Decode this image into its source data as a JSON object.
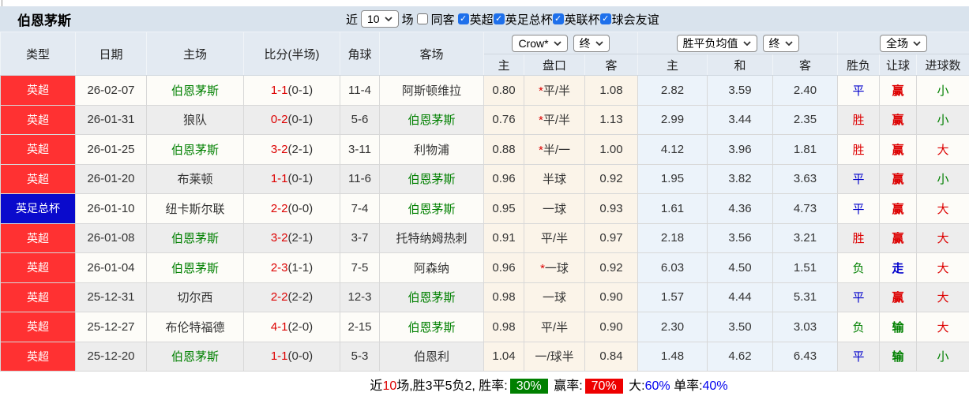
{
  "page": {
    "title": "伯恩茅斯"
  },
  "toolbar": {
    "near_label": "近",
    "matches_count": "10",
    "matches_label": "场",
    "same_opponent": {
      "label": "同客",
      "checked": false
    },
    "league_filters": [
      {
        "label": "英超",
        "checked": true
      },
      {
        "label": "英足总杯",
        "checked": true
      },
      {
        "label": "英联杯",
        "checked": true
      },
      {
        "label": "球会友谊",
        "checked": true
      }
    ]
  },
  "table": {
    "headers": {
      "type": "类型",
      "date": "日期",
      "home": "主场",
      "score": "比分(半场)",
      "corner": "角球",
      "away": "客场",
      "odds_company_select": "Crow*",
      "odds_time_select": "终",
      "odds_cols": {
        "home": "主",
        "handicap": "盘口",
        "away": "客"
      },
      "avg_select": "胜平负均值",
      "avg_time_select": "终",
      "avg_cols": {
        "home": "主",
        "draw": "和",
        "away": "客"
      },
      "scope_select": "全场",
      "result_cols": {
        "result": "胜负",
        "handicap": "让球",
        "goals": "进球数"
      }
    },
    "rows": [
      {
        "league": "英超",
        "league_color": "red",
        "date": "26-02-07",
        "home": {
          "name": "伯恩茅斯",
          "highlight": true
        },
        "score": {
          "full": "1-1",
          "half": "(0-1)"
        },
        "corners": "11-4",
        "away": {
          "name": "阿斯顿维拉",
          "highlight": false
        },
        "odds": {
          "home": "0.80",
          "star": "*",
          "handicap": "平/半",
          "away": "1.08"
        },
        "avg": {
          "home": "2.82",
          "draw": "3.59",
          "away": "2.40"
        },
        "result": {
          "text": "平",
          "color": "blue"
        },
        "handicap_result": {
          "text": "赢",
          "color": "red"
        },
        "goals_result": {
          "text": "小",
          "color": "green"
        }
      },
      {
        "league": "英超",
        "league_color": "red",
        "date": "26-01-31",
        "home": {
          "name": "狼队",
          "highlight": false
        },
        "score": {
          "full": "0-2",
          "half": "(0-1)"
        },
        "corners": "5-6",
        "away": {
          "name": "伯恩茅斯",
          "highlight": true
        },
        "odds": {
          "home": "0.76",
          "star": "*",
          "handicap": "平/半",
          "away": "1.13"
        },
        "avg": {
          "home": "2.99",
          "draw": "3.44",
          "away": "2.35"
        },
        "result": {
          "text": "胜",
          "color": "red"
        },
        "handicap_result": {
          "text": "赢",
          "color": "red"
        },
        "goals_result": {
          "text": "小",
          "color": "green"
        }
      },
      {
        "league": "英超",
        "league_color": "red",
        "date": "26-01-25",
        "home": {
          "name": "伯恩茅斯",
          "highlight": true
        },
        "score": {
          "full": "3-2",
          "half": "(2-1)"
        },
        "corners": "3-11",
        "away": {
          "name": "利物浦",
          "highlight": false
        },
        "odds": {
          "home": "0.88",
          "star": "*",
          "handicap": "半/一",
          "away": "1.00"
        },
        "avg": {
          "home": "4.12",
          "draw": "3.96",
          "away": "1.81"
        },
        "result": {
          "text": "胜",
          "color": "red"
        },
        "handicap_result": {
          "text": "赢",
          "color": "red"
        },
        "goals_result": {
          "text": "大",
          "color": "red"
        }
      },
      {
        "league": "英超",
        "league_color": "red",
        "date": "26-01-20",
        "home": {
          "name": "布莱顿",
          "highlight": false
        },
        "score": {
          "full": "1-1",
          "half": "(0-1)"
        },
        "corners": "11-6",
        "away": {
          "name": "伯恩茅斯",
          "highlight": true
        },
        "odds": {
          "home": "0.96",
          "star": "",
          "handicap": "半球",
          "away": "0.92"
        },
        "avg": {
          "home": "1.95",
          "draw": "3.82",
          "away": "3.63"
        },
        "result": {
          "text": "平",
          "color": "blue"
        },
        "handicap_result": {
          "text": "赢",
          "color": "red"
        },
        "goals_result": {
          "text": "小",
          "color": "green"
        }
      },
      {
        "league": "英足总杯",
        "league_color": "blue",
        "date": "26-01-10",
        "home": {
          "name": "纽卡斯尔联",
          "highlight": false
        },
        "score": {
          "full": "2-2",
          "half": "(0-0)"
        },
        "corners": "7-4",
        "away": {
          "name": "伯恩茅斯",
          "highlight": true
        },
        "odds": {
          "home": "0.95",
          "star": "",
          "handicap": "一球",
          "away": "0.93"
        },
        "avg": {
          "home": "1.61",
          "draw": "4.36",
          "away": "4.73"
        },
        "result": {
          "text": "平",
          "color": "blue"
        },
        "handicap_result": {
          "text": "赢",
          "color": "red"
        },
        "goals_result": {
          "text": "大",
          "color": "red"
        }
      },
      {
        "league": "英超",
        "league_color": "red",
        "date": "26-01-08",
        "home": {
          "name": "伯恩茅斯",
          "highlight": true
        },
        "score": {
          "full": "3-2",
          "half": "(2-1)"
        },
        "corners": "3-7",
        "away": {
          "name": "托特纳姆热刺",
          "highlight": false
        },
        "odds": {
          "home": "0.91",
          "star": "",
          "handicap": "平/半",
          "away": "0.97"
        },
        "avg": {
          "home": "2.18",
          "draw": "3.56",
          "away": "3.21"
        },
        "result": {
          "text": "胜",
          "color": "red"
        },
        "handicap_result": {
          "text": "赢",
          "color": "red"
        },
        "goals_result": {
          "text": "大",
          "color": "red"
        }
      },
      {
        "league": "英超",
        "league_color": "red",
        "date": "26-01-04",
        "home": {
          "name": "伯恩茅斯",
          "highlight": true
        },
        "score": {
          "full": "2-3",
          "half": "(1-1)"
        },
        "corners": "7-5",
        "away": {
          "name": "阿森纳",
          "highlight": false
        },
        "odds": {
          "home": "0.96",
          "star": "*",
          "handicap": "一球",
          "away": "0.92"
        },
        "avg": {
          "home": "6.03",
          "draw": "4.50",
          "away": "1.51"
        },
        "result": {
          "text": "负",
          "color": "green"
        },
        "handicap_result": {
          "text": "走",
          "color": "blue"
        },
        "goals_result": {
          "text": "大",
          "color": "red"
        }
      },
      {
        "league": "英超",
        "league_color": "red",
        "date": "25-12-31",
        "home": {
          "name": "切尔西",
          "highlight": false
        },
        "score": {
          "full": "2-2",
          "half": "(2-2)"
        },
        "corners": "12-3",
        "away": {
          "name": "伯恩茅斯",
          "highlight": true
        },
        "odds": {
          "home": "0.98",
          "star": "",
          "handicap": "一球",
          "away": "0.90"
        },
        "avg": {
          "home": "1.57",
          "draw": "4.44",
          "away": "5.31"
        },
        "result": {
          "text": "平",
          "color": "blue"
        },
        "handicap_result": {
          "text": "赢",
          "color": "red"
        },
        "goals_result": {
          "text": "大",
          "color": "red"
        }
      },
      {
        "league": "英超",
        "league_color": "red",
        "date": "25-12-27",
        "home": {
          "name": "布伦特福德",
          "highlight": false
        },
        "score": {
          "full": "4-1",
          "half": "(2-0)"
        },
        "corners": "2-15",
        "away": {
          "name": "伯恩茅斯",
          "highlight": true
        },
        "odds": {
          "home": "0.98",
          "star": "",
          "handicap": "平/半",
          "away": "0.90"
        },
        "avg": {
          "home": "2.30",
          "draw": "3.50",
          "away": "3.03"
        },
        "result": {
          "text": "负",
          "color": "green"
        },
        "handicap_result": {
          "text": "输",
          "color": "green"
        },
        "goals_result": {
          "text": "大",
          "color": "red"
        }
      },
      {
        "league": "英超",
        "league_color": "red",
        "date": "25-12-20",
        "home": {
          "name": "伯恩茅斯",
          "highlight": true
        },
        "score": {
          "full": "1-1",
          "half": "(0-0)"
        },
        "corners": "5-3",
        "away": {
          "name": "伯恩利",
          "highlight": false
        },
        "odds": {
          "home": "1.04",
          "star": "",
          "handicap": "一/球半",
          "away": "0.84"
        },
        "avg": {
          "home": "1.48",
          "draw": "4.62",
          "away": "6.43"
        },
        "result": {
          "text": "平",
          "color": "blue"
        },
        "handicap_result": {
          "text": "输",
          "color": "green"
        },
        "goals_result": {
          "text": "小",
          "color": "green"
        }
      }
    ]
  },
  "footer": {
    "segments": [
      {
        "text": "近"
      },
      {
        "text": "10",
        "color": "red"
      },
      {
        "text": "场,胜3平5负2, 胜率:"
      },
      {
        "text": "30%",
        "badge": "green"
      },
      {
        "text": " 赢率:"
      },
      {
        "text": "70%",
        "badge": "red"
      },
      {
        "text": " 大:"
      },
      {
        "text": "60%",
        "color": "blue"
      },
      {
        "text": " 单率:"
      },
      {
        "text": "40%",
        "color": "blue"
      }
    ]
  },
  "colors": {
    "league_premier_badge": "#ff3132",
    "league_facup_badge": "#0a0acc",
    "score_red": "#dd0000",
    "highlight_team_green": "#008000",
    "draw_blue": "#0000cc",
    "summary_green_bg": "#008000",
    "summary_red_bg": "#ee0000",
    "summary_percent_blue": "#0000ee",
    "titlebar_bg": "#d9e3ed",
    "header_bg": "#e3eaf2",
    "odds_col_bg": "#fbf4e9",
    "avg_col_bg": "#ecf3fa"
  }
}
